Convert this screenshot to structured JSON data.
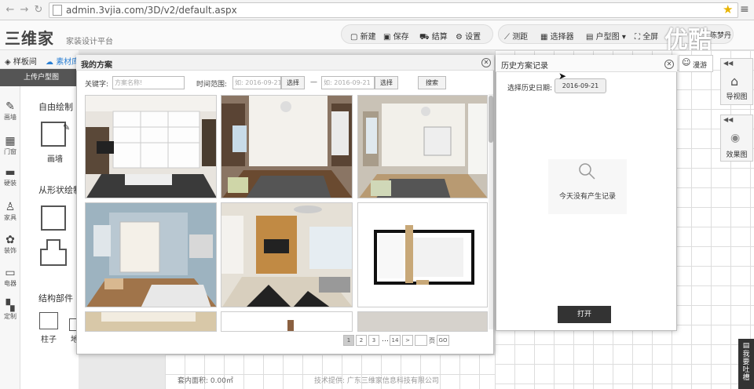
{
  "browser": {
    "url": "admin.3vjia.com/3D/v2/default.aspx"
  },
  "app": {
    "logo": "三维家",
    "slogan": "家装设计平台"
  },
  "toolbar": {
    "new": "新建",
    "save": "保存",
    "checkout": "结算",
    "settings": "设置",
    "measure": "测距",
    "select": "选择器",
    "floorplan": "户型图",
    "fullscreen": "全屏",
    "user": "陈梦丹"
  },
  "watermark": "优酷",
  "left": {
    "tab1": "样板间",
    "tab2": "素材库",
    "upload": "上传户型图",
    "nav": [
      "画墙",
      "门窗",
      "硬装",
      "家具",
      "装饰",
      "电器",
      "定制"
    ],
    "free_draw": "自由绘制",
    "draw_wall": "画墙",
    "shape_draw": "从形状绘制",
    "structure": "结构部件",
    "column": "柱子",
    "column2": "地"
  },
  "dialog": {
    "title": "我的方案",
    "keyword_label": "关键字:",
    "keyword_placeholder": "方案名称!",
    "time_label": "时间范围:",
    "date_placeholder1": "如: 2016-09-21",
    "date_placeholder2": "如: 2016-09-21",
    "select1": "选择",
    "select2": "选择",
    "dash": "—",
    "search": "搜索",
    "pagination": {
      "p1": "1",
      "p2": "2",
      "p3": "3",
      "ellipsis": "…",
      "p14": "14",
      "next": ">",
      "page_label": "页",
      "go": "GO"
    }
  },
  "history": {
    "title": "历史方案记录",
    "date_label": "选择历史日期:",
    "date": "2016-09-21",
    "empty": "今天没有产生记录",
    "open": "打开"
  },
  "right": {
    "roam": "漫游",
    "nav_view": "导视图",
    "render": "效果图"
  },
  "footer": {
    "area": "套内面积: 0.00㎡",
    "tech": "技术提供: 广东三维家信息科技有限公司"
  },
  "tucao": "我要吐槽"
}
